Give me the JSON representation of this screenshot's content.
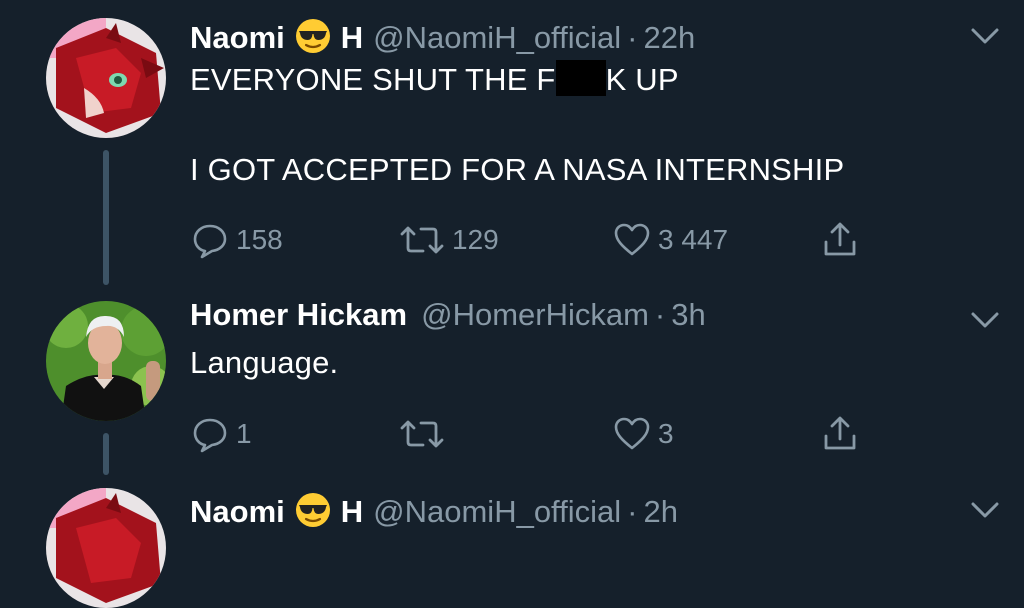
{
  "colors": {
    "background": "#15202b",
    "text": "#ffffff",
    "secondary": "#8899a6",
    "thread_line": "#3d5466"
  },
  "tweets": [
    {
      "name_first": "Naomi",
      "emoji": "smiling-face-with-sunglasses",
      "name_last": "H",
      "handle": "@NaomiH_official",
      "dot": "·",
      "time": "22h",
      "line1_prefix": "EVERYONE SHUT THE F",
      "line1_suffix": "K UP",
      "line2": "I GOT ACCEPTED FOR A NASA INTERNSHIP",
      "replies": "158",
      "retweets": "129",
      "likes": "3 447"
    },
    {
      "name": "Homer Hickam",
      "handle": "@HomerHickam",
      "dot": "·",
      "time": "3h",
      "text": "Language.",
      "replies": "1",
      "retweets": "",
      "likes": "3"
    },
    {
      "name_first": "Naomi",
      "emoji": "smiling-face-with-sunglasses",
      "name_last": "H",
      "handle": "@NaomiH_official",
      "dot": "·",
      "time": "2h"
    }
  ]
}
